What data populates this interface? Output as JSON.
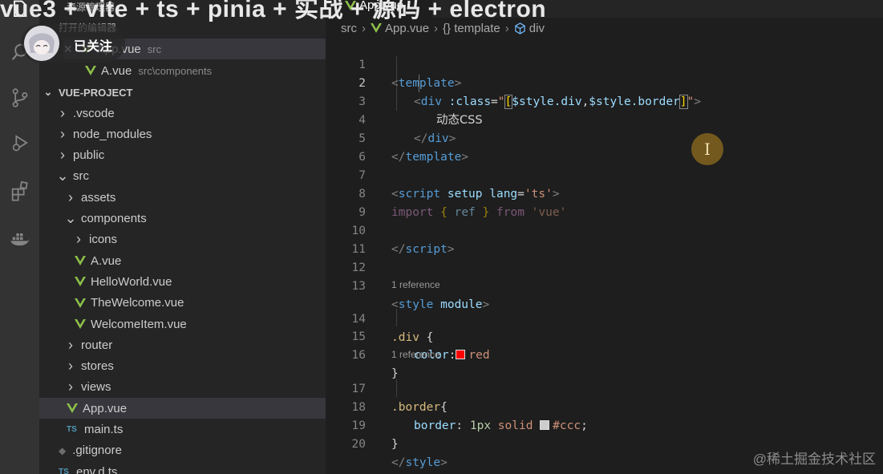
{
  "overlay": {
    "title_fragment": "vue3 + vite + ts + pinia + 实战 + 源码 + electron",
    "follow_label": "已关注",
    "open_editors_label": "打开的编辑器",
    "explorer_label": "资源管理器"
  },
  "editor_tabs": [
    {
      "label": "App.vue"
    }
  ],
  "open_editors": [
    {
      "name": "App.vue",
      "path": "src"
    },
    {
      "name": "A.vue",
      "path": "src\\components"
    }
  ],
  "project": {
    "name": "VUE-PROJECT"
  },
  "tree": [
    {
      "label": ".vscode",
      "type": "folder",
      "open": false,
      "depth": 0
    },
    {
      "label": "node_modules",
      "type": "folder",
      "open": false,
      "depth": 0
    },
    {
      "label": "public",
      "type": "folder",
      "open": false,
      "depth": 0
    },
    {
      "label": "src",
      "type": "folder",
      "open": true,
      "depth": 0
    },
    {
      "label": "assets",
      "type": "folder",
      "open": false,
      "depth": 1
    },
    {
      "label": "components",
      "type": "folder",
      "open": true,
      "depth": 1
    },
    {
      "label": "icons",
      "type": "folder",
      "open": false,
      "depth": 2
    },
    {
      "label": "A.vue",
      "type": "vue",
      "depth": 2
    },
    {
      "label": "HelloWorld.vue",
      "type": "vue",
      "depth": 2
    },
    {
      "label": "TheWelcome.vue",
      "type": "vue",
      "depth": 2
    },
    {
      "label": "WelcomeItem.vue",
      "type": "vue",
      "depth": 2
    },
    {
      "label": "router",
      "type": "folder",
      "open": false,
      "depth": 1
    },
    {
      "label": "stores",
      "type": "folder",
      "open": false,
      "depth": 1
    },
    {
      "label": "views",
      "type": "folder",
      "open": false,
      "depth": 1
    },
    {
      "label": "App.vue",
      "type": "vue",
      "depth": 1,
      "selected": true
    },
    {
      "label": "main.ts",
      "type": "ts",
      "depth": 1
    },
    {
      "label": ".gitignore",
      "type": "git",
      "depth": 0
    },
    {
      "label": "env.d.ts",
      "type": "ts",
      "depth": 0
    }
  ],
  "breadcrumb": {
    "folder": "src",
    "file": "App.vue",
    "template": "{} template",
    "element": "div"
  },
  "code": {
    "line_numbers": [
      "1",
      "2",
      "3",
      "4",
      "5",
      "6",
      "7",
      "8",
      "9",
      "10",
      "11",
      "12",
      "13",
      "14",
      "15",
      "16",
      "17",
      "18",
      "19",
      "20"
    ],
    "lens_text": "1 reference",
    "l1_open": "<",
    "l1_tag": "template",
    "l1_close": ">",
    "l2_open": "<",
    "l2_tag": "div",
    "l2_attr": " :class",
    "l2_eq": "=",
    "l2_q": "\"",
    "l2_lb": "[",
    "l2_v1": "$style.div",
    "l2_comma": ",",
    "l2_v2": "$style.border",
    "l2_rb": "]",
    "l2_q2": "\"",
    "l2_close": ">",
    "l3_text": "动态CSS",
    "l4_open": "</",
    "l4_tag": "div",
    "l4_close": ">",
    "l5_open": "</",
    "l5_tag": "template",
    "l5_close": ">",
    "l7_open": "<",
    "l7_tag": "script",
    "l7_attr1": " setup",
    "l7_attr2": " lang",
    "l7_eq": "=",
    "l7_val": "'ts'",
    "l7_close": ">",
    "l8_import": "import",
    "l8_lb": " { ",
    "l8_ref": "ref",
    "l8_rb": " } ",
    "l8_from": "from",
    "l8_str": " 'vue'",
    "l10_open": "</",
    "l10_tag": "script",
    "l10_close": ">",
    "l13_open": "<",
    "l13_tag": "style",
    "l13_attr": " module",
    "l13_close": ">",
    "l14_sel": ".div",
    "l14_brace": " {",
    "l15_prop": "color",
    "l15_colon": ":",
    "l15_val": "red",
    "l16_brace": "}",
    "l17_sel": ".border",
    "l17_brace": "{",
    "l18_prop": "border",
    "l18_colon": ": ",
    "l18_num": "1px",
    "l18_solid": " solid ",
    "l18_val": "#ccc",
    "l18_semi": ";",
    "l19_brace": "}",
    "l20_open": "</",
    "l20_tag": "style",
    "l20_close": ">"
  },
  "colors": {
    "swatch_red": "#ff0000",
    "swatch_ccc": "#cccccc",
    "vue_green": "#8dc149",
    "accent": "#569cd6"
  },
  "watermark": "@稀土掘金技术社区"
}
